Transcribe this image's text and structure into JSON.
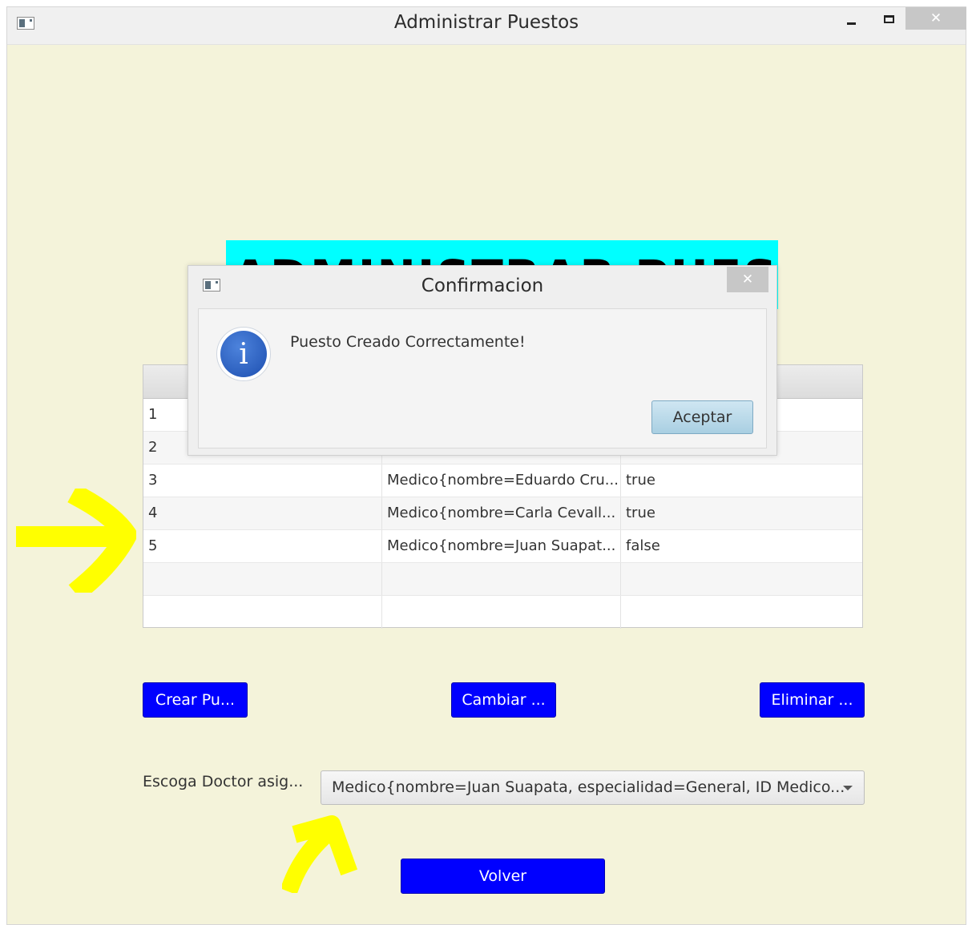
{
  "window": {
    "title": "Administrar Puestos",
    "close_glyph": "✕"
  },
  "heading_banner": {
    "text": "ADMINISTRAR PUESTOS",
    "background": "#00ffff"
  },
  "table": {
    "rows": [
      {
        "col1": "1",
        "col2": "",
        "col3": ""
      },
      {
        "col1": "2",
        "col2": "",
        "col3": ""
      },
      {
        "col1": "3",
        "col2": "Medico{nombre=Eduardo Cru...",
        "col3": "true"
      },
      {
        "col1": "4",
        "col2": "Medico{nombre=Carla Cevall...",
        "col3": "true"
      },
      {
        "col1": "5",
        "col2": "Medico{nombre=Juan Suapat...",
        "col3": "false"
      },
      {
        "col1": "",
        "col2": "",
        "col3": ""
      },
      {
        "col1": "",
        "col2": "",
        "col3": ""
      }
    ]
  },
  "buttons": {
    "crear": "Crear Pu...",
    "cambiar": "Cambiar ...",
    "eliminar": "Eliminar ...",
    "volver": "Volver",
    "color": "#0000ff"
  },
  "doctor_select": {
    "label": "Escoga Doctor asig...",
    "value": "Medico{nombre=Juan Suapata, especialidad=General, ID Medico..."
  },
  "dialog": {
    "title": "Confirmacion",
    "close_glyph": "✕",
    "message": "Puesto Creado Correctamente!",
    "icon_glyph": "i",
    "accept_label": "Aceptar"
  },
  "annotations": {
    "color": "#ffff00"
  }
}
